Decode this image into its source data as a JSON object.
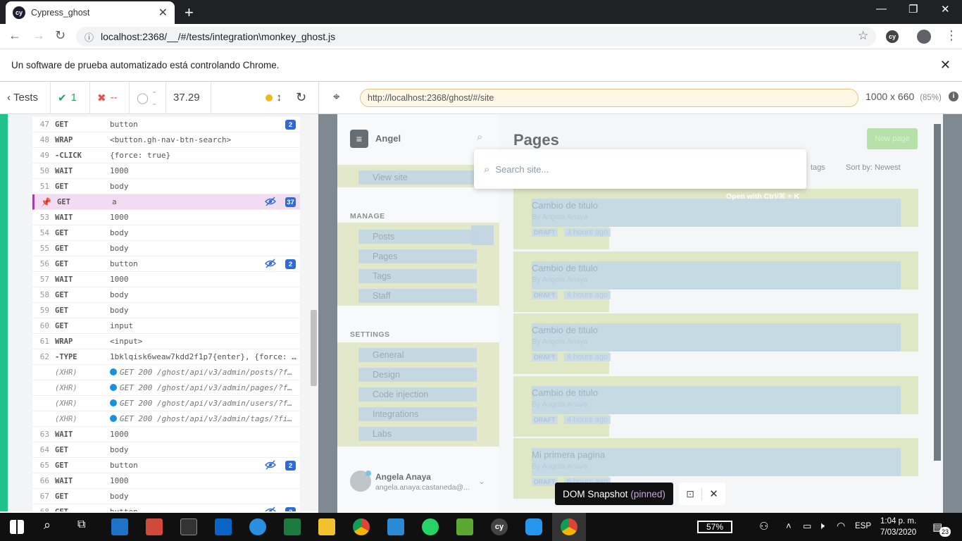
{
  "browser": {
    "tab_title": "Cypress_ghost",
    "url": "localhost:2368/__/#/tests/integration\\monkey_ghost.js",
    "infobar_text": "Un software de prueba automatizado está controlando Chrome."
  },
  "reporter": {
    "tests_label": "Tests",
    "passed": "1",
    "failed": "--",
    "pending": "--",
    "duration": "37.29"
  },
  "commands": [
    {
      "num": "47",
      "name": "GET",
      "msg": "button",
      "badge": "2",
      "eye": false
    },
    {
      "num": "48",
      "name": "WRAP",
      "msg": "<button.gh-nav-btn-search>",
      "badge": "",
      "eye": false
    },
    {
      "num": "49",
      "name": "-CLICK",
      "msg": "{force: true}",
      "badge": "",
      "eye": false
    },
    {
      "num": "50",
      "name": "WAIT",
      "msg": "1000",
      "badge": "",
      "eye": false
    },
    {
      "num": "51",
      "name": "GET",
      "msg": "body",
      "badge": "",
      "eye": false
    },
    {
      "num": "",
      "name": "GET",
      "msg": "a",
      "badge": "37",
      "eye": true,
      "pinned": true
    },
    {
      "num": "53",
      "name": "WAIT",
      "msg": "1000",
      "badge": "",
      "eye": false
    },
    {
      "num": "54",
      "name": "GET",
      "msg": "body",
      "badge": "",
      "eye": false
    },
    {
      "num": "55",
      "name": "GET",
      "msg": "body",
      "badge": "",
      "eye": false
    },
    {
      "num": "56",
      "name": "GET",
      "msg": "button",
      "badge": "2",
      "eye": true
    },
    {
      "num": "57",
      "name": "WAIT",
      "msg": "1000",
      "badge": "",
      "eye": false
    },
    {
      "num": "58",
      "name": "GET",
      "msg": "body",
      "badge": "",
      "eye": false
    },
    {
      "num": "59",
      "name": "GET",
      "msg": "body",
      "badge": "",
      "eye": false
    },
    {
      "num": "60",
      "name": "GET",
      "msg": "input",
      "badge": "",
      "eye": false
    },
    {
      "num": "61",
      "name": "WRAP",
      "msg": "<input>",
      "badge": "",
      "eye": false
    },
    {
      "num": "62",
      "name": "-TYPE",
      "msg": "1bklqisk6weaw7kdd2f1p7{enter}, {force: …",
      "badge": "",
      "eye": false
    },
    {
      "num": "",
      "name": "(XHR)",
      "msg": "GET 200 /ghost/api/v3/admin/posts/?f…",
      "badge": "",
      "eye": false,
      "xhr": true
    },
    {
      "num": "",
      "name": "(XHR)",
      "msg": "GET 200 /ghost/api/v3/admin/pages/?f…",
      "badge": "",
      "eye": false,
      "xhr": true
    },
    {
      "num": "",
      "name": "(XHR)",
      "msg": "GET 200 /ghost/api/v3/admin/users/?f…",
      "badge": "",
      "eye": false,
      "xhr": true
    },
    {
      "num": "",
      "name": "(XHR)",
      "msg": "GET 200 /ghost/api/v3/admin/tags/?fi…",
      "badge": "",
      "eye": false,
      "xhr": true
    },
    {
      "num": "63",
      "name": "WAIT",
      "msg": "1000",
      "badge": "",
      "eye": false
    },
    {
      "num": "64",
      "name": "GET",
      "msg": "body",
      "badge": "",
      "eye": false
    },
    {
      "num": "65",
      "name": "GET",
      "msg": "button",
      "badge": "2",
      "eye": true
    },
    {
      "num": "66",
      "name": "WAIT",
      "msg": "1000",
      "badge": "",
      "eye": false
    },
    {
      "num": "67",
      "name": "GET",
      "msg": "body",
      "badge": "",
      "eye": false
    },
    {
      "num": "68",
      "name": "GET",
      "msg": "button",
      "badge": "2",
      "eye": true
    }
  ],
  "aut": {
    "url": "http://localhost:2368/ghost/#/site",
    "viewport": "1000 x 660",
    "scale": "(85%)"
  },
  "ghost": {
    "site_name": "Angel",
    "page_title": "Pages",
    "new_page": "New page",
    "filter_tags": "tags",
    "sort": "Sort by: Newest",
    "view_site": "View site",
    "manage_label": "MANAGE",
    "settings_label": "SETTINGS",
    "manage_items": [
      "Posts",
      "Pages",
      "Tags",
      "Staff"
    ],
    "settings_items": [
      "General",
      "Design",
      "Code injection",
      "Integrations",
      "Labs"
    ],
    "user_name": "Angela Anaya",
    "user_email": "angela.anaya.castaneda@...",
    "search_placeholder": "Search site...",
    "search_hint": "Open with Ctrl/⌘ + K",
    "pages": [
      {
        "title": "Cambio de titulo",
        "by": "By Angela Anaya",
        "status": "DRAFT",
        "time": "3 hours ago"
      },
      {
        "title": "Cambio de titulo",
        "by": "By Angela Anaya",
        "status": "DRAFT",
        "time": "4 hours ago"
      },
      {
        "title": "Cambio de titulo",
        "by": "By Angela Anaya",
        "status": "DRAFT",
        "time": "4 hours ago"
      },
      {
        "title": "Cambio de titulo",
        "by": "By Angela Anaya",
        "status": "DRAFT",
        "time": "4 hours ago"
      },
      {
        "title": "Mi primera pagina",
        "by": "By Angela Anaya",
        "status": "DRAFT",
        "time": "6 hours ago"
      }
    ]
  },
  "snapshot": {
    "label": "DOM Snapshot",
    "pinned": "(pinned)"
  },
  "taskbar": {
    "battery": "57%",
    "lang": "ESP",
    "time": "1:04 p. m.",
    "date": "7/03/2020",
    "notifications": "23"
  }
}
